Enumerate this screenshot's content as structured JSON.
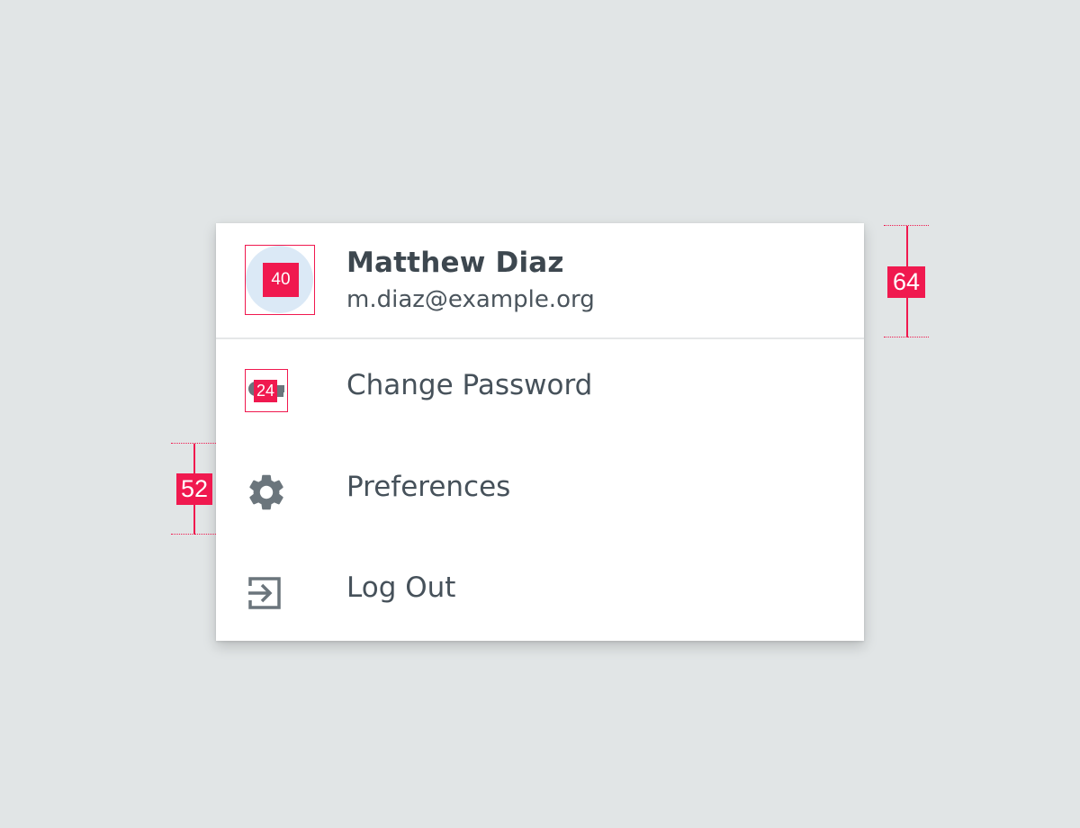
{
  "user": {
    "name": "Matthew Diaz",
    "email": "m.diaz@example.org"
  },
  "menu": {
    "items": [
      {
        "label": "Change Password",
        "icon": "key-icon"
      },
      {
        "label": "Preferences",
        "icon": "gear-icon"
      },
      {
        "label": "Log Out",
        "icon": "logout-icon"
      }
    ]
  },
  "annotations": {
    "avatar_size": "40",
    "icon_size": "24",
    "header_height": "64",
    "item_height": "52"
  },
  "colors": {
    "background": "#e1e5e6",
    "card": "#ffffff",
    "annotation": "#f0194f",
    "icon": "#6b757c",
    "text": "#46515a",
    "avatar": "#dbe9f6"
  }
}
